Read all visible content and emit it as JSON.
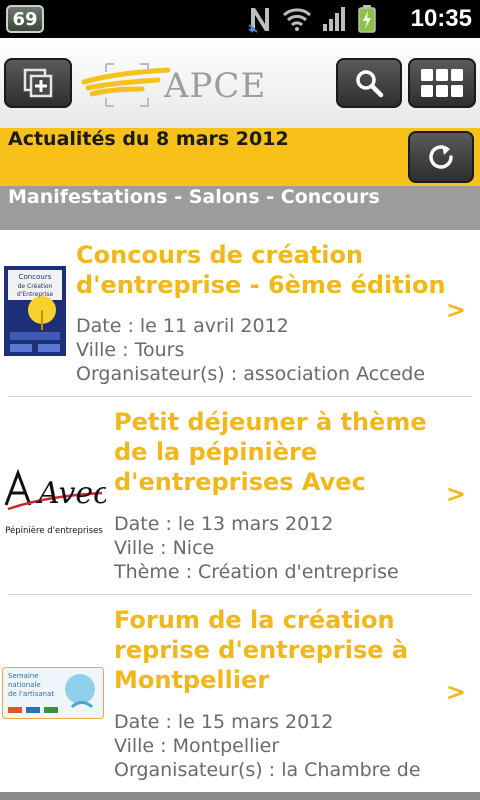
{
  "status_bar": {
    "battery_level": "69",
    "time": "10:35"
  },
  "header": {
    "logo_text": "APCE"
  },
  "date_bar": {
    "title": "Actualités du 8 mars 2012"
  },
  "section": {
    "title": "Manifestations - Salons - Concours"
  },
  "items": [
    {
      "title_lines": [
        "Concours de création",
        "d'entreprise - 6ème édition"
      ],
      "lines": [
        "Date : le 11 avril 2012",
        "Ville : Tours",
        "Organisateur(s) : association Accede"
      ],
      "thumb_text": [
        "Concours",
        "de Création",
        "d'Entreprise"
      ]
    },
    {
      "title_lines": [
        "Petit déjeuner à thème",
        "de la pépinière",
        "d'entreprises Avec"
      ],
      "lines": [
        "Date : le 13 mars 2012",
        "Ville : Nice",
        "Thème : Création d'entreprise"
      ],
      "thumb_text": [
        "Avec",
        "Pépinière d'entreprises"
      ]
    },
    {
      "title_lines": [
        "Forum de la création",
        "reprise d'entreprise à",
        "Montpellier"
      ],
      "lines": [
        "Date : le 15 mars 2012",
        "Ville : Montpellier",
        "Organisateur(s) : la Chambre de"
      ],
      "thumb_text": [
        "Semaine",
        "nationale",
        "de l'artisanat"
      ]
    }
  ],
  "chevron": ">"
}
